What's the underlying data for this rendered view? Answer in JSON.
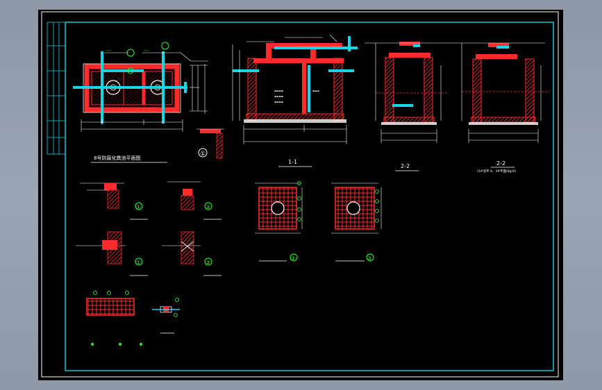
{
  "drawing": {
    "plan_title": "8号防腐化粪池平面图",
    "section_1_label": "1-1",
    "section_2_label": "2-2",
    "section_3_label": "2-2",
    "section_3_note": "(3#池平-4、3#平面(8g)X)",
    "callout_1": "①",
    "callout_2": "②",
    "colors": {
      "frame": "#19d3e6",
      "wall": "#ff2a2a",
      "pipe": "#19d3e6",
      "leader": "#ffffff",
      "dim": "#22ff22"
    }
  },
  "icons": {
    "background": "cad-model-space",
    "pipe": "cyan-pipe",
    "callout": "circled-number-green"
  }
}
